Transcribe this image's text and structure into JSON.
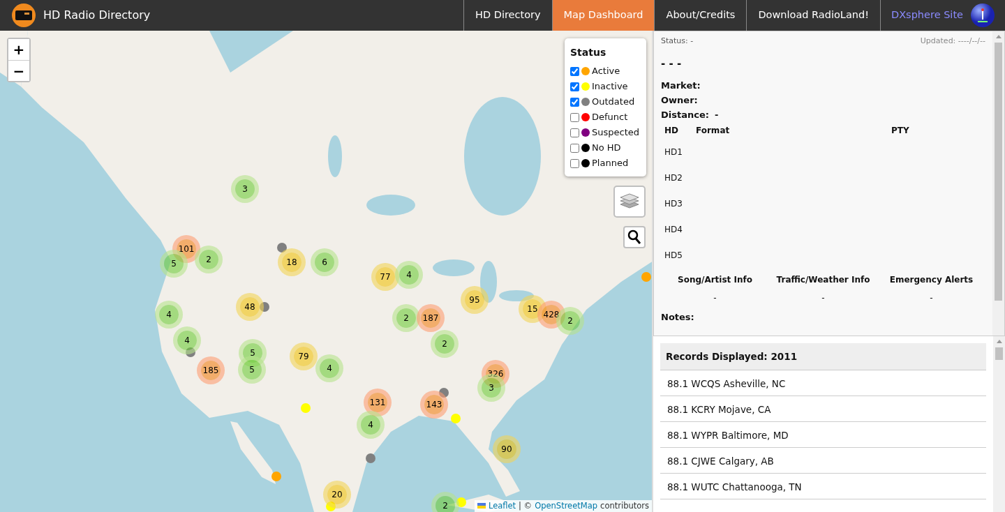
{
  "navbar": {
    "brand": "HD Radio Directory",
    "links": [
      {
        "label": "HD Directory",
        "selected": false
      },
      {
        "label": "Map Dashboard",
        "selected": true
      },
      {
        "label": "About/Credits",
        "selected": false
      },
      {
        "label": "Download RadioLand!",
        "selected": false
      }
    ],
    "site_link": "DXsphere Site"
  },
  "map": {
    "zoom_in": "+",
    "zoom_out": "−",
    "legend": {
      "title": "Status",
      "items": [
        {
          "label": "Active",
          "color": "#ffa500",
          "checked": true
        },
        {
          "label": "Inactive",
          "color": "#ffff00",
          "checked": true
        },
        {
          "label": "Outdated",
          "color": "#808080",
          "checked": true
        },
        {
          "label": "Defunct",
          "color": "#ff0000",
          "checked": false
        },
        {
          "label": "Suspected",
          "color": "#800080",
          "checked": false
        },
        {
          "label": "No HD",
          "color": "#000000",
          "checked": false
        },
        {
          "label": "Planned",
          "color": "#000000",
          "checked": false
        }
      ]
    },
    "clusters": [
      {
        "count": "3",
        "kind": "small"
      },
      {
        "count": "101",
        "kind": "large"
      },
      {
        "count": "5",
        "kind": "small"
      },
      {
        "count": "2",
        "kind": "small"
      },
      {
        "count": "18",
        "kind": "medium"
      },
      {
        "count": "6",
        "kind": "small"
      },
      {
        "count": "77",
        "kind": "medium"
      },
      {
        "count": "4",
        "kind": "small"
      },
      {
        "count": "95",
        "kind": "medium"
      },
      {
        "count": "15",
        "kind": "medium"
      },
      {
        "count": "428",
        "kind": "large"
      },
      {
        "count": "2",
        "kind": "small"
      },
      {
        "count": "48",
        "kind": "medium"
      },
      {
        "count": "4",
        "kind": "small"
      },
      {
        "count": "2",
        "kind": "small"
      },
      {
        "count": "187",
        "kind": "large"
      },
      {
        "count": "2",
        "kind": "small"
      },
      {
        "count": "4",
        "kind": "small"
      },
      {
        "count": "5",
        "kind": "small"
      },
      {
        "count": "79",
        "kind": "medium"
      },
      {
        "count": "185",
        "kind": "large"
      },
      {
        "count": "5",
        "kind": "small"
      },
      {
        "count": "4",
        "kind": "small"
      },
      {
        "count": "326",
        "kind": "large"
      },
      {
        "count": "3",
        "kind": "small"
      },
      {
        "count": "131",
        "kind": "large"
      },
      {
        "count": "143",
        "kind": "large"
      },
      {
        "count": "4",
        "kind": "small"
      },
      {
        "count": "90",
        "kind": "medium"
      },
      {
        "count": "20",
        "kind": "medium"
      },
      {
        "count": "2",
        "kind": "small"
      }
    ],
    "stations": [
      {
        "color": "#808080"
      },
      {
        "color": "#808080"
      },
      {
        "color": "#ffa500"
      },
      {
        "color": "#808080"
      },
      {
        "color": "#808080"
      },
      {
        "color": "#ffff00"
      },
      {
        "color": "#ffff00"
      },
      {
        "color": "#808080"
      },
      {
        "color": "#ffa500"
      },
      {
        "color": "#ffff00"
      },
      {
        "color": "#ffff00"
      }
    ],
    "attribution": {
      "link_1": "Leaflet",
      "separator": "| ©",
      "link_2": "OpenStreetMap",
      "suffix": "contributors"
    }
  },
  "details": {
    "status": "Status: -",
    "updated": "Updated: ----/--/--",
    "call_sign": "- - -",
    "fields": [
      {
        "label": "Market:"
      },
      {
        "label": "Owner:"
      },
      {
        "label": "Distance:",
        "value": "-"
      }
    ],
    "table": {
      "columns": [
        "HD",
        "Format",
        "PTY"
      ],
      "rows": [
        "HD1",
        "HD2",
        "HD3",
        "HD4",
        "HD5"
      ]
    },
    "features": [
      {
        "label": "Song/Artist Info",
        "value": "-"
      },
      {
        "label": "Traffic/Weather Info",
        "value": "-"
      },
      {
        "label": "Emergency Alerts",
        "value": "-"
      }
    ],
    "notes_label": "Notes:"
  },
  "records": {
    "header": "Records Displayed: 2011",
    "items": [
      "88.1 WCQS Asheville, NC",
      "88.1 KCRY Mojave, CA",
      "88.1 WYPR Baltimore, MD",
      "88.1 CJWE Calgary, AB",
      "88.1 WUTC Chattanooga, TN"
    ]
  }
}
